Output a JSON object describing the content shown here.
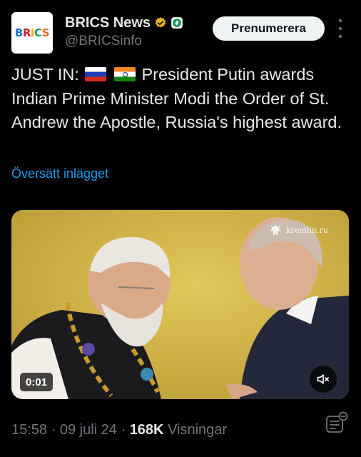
{
  "author": {
    "avatar_logo": "BRICS",
    "display_name": "BRICS News",
    "handle": "@BRICSinfo",
    "badges": [
      "verified-icon",
      "affiliate-icon"
    ]
  },
  "actions": {
    "subscribe_label": "Prenumerera"
  },
  "tweet": {
    "text_prefix": "JUST IN:",
    "flags": [
      "flag-russia",
      "flag-india"
    ],
    "text_body": "President Putin awards Indian Prime Minister Modi the Order of St. Andrew the Apostle, Russia's highest award.",
    "translate_label": "Översätt inlägget"
  },
  "media": {
    "type": "video",
    "watermark": "kremlin.ru",
    "elapsed": "0:01",
    "muted": true
  },
  "meta": {
    "time": "15:58",
    "separator": " · ",
    "date": "09 juli 24",
    "views_count": "168K",
    "views_label": "Visningar"
  },
  "colors": {
    "background": "#000000",
    "text": "#e7e9ea",
    "secondary": "#71767b",
    "link": "#1d9bf0",
    "button_bg": "#eff3f4"
  }
}
